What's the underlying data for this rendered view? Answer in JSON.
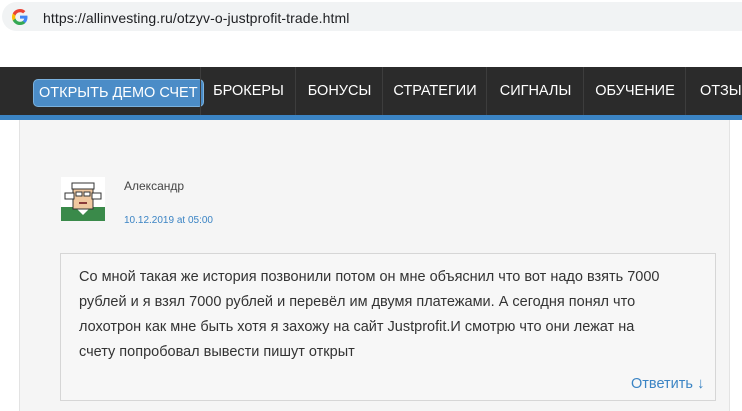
{
  "browser": {
    "url": "https://allinvesting.ru/otzyv-o-justprofit-trade.html",
    "favicon_icon": "google-g-icon"
  },
  "nav": {
    "demo_button": "ОТКРЫТЬ ДЕМО СЧЕТ",
    "items": [
      "БРОКЕРЫ",
      "БОНУСЫ",
      "СТРАТЕГИИ",
      "СИГНАЛЫ",
      "ОБУЧЕНИЕ",
      "ОТЗЫВЫ"
    ],
    "accent_color": "#3b84c4"
  },
  "comment": {
    "avatar_icon": "avatar-icon",
    "author": "Александр",
    "date": "10.12.2019 at 05:00",
    "lines": [
      "Со мной такая же история позвонили потом он мне объяснил что вот надо взять 7000",
      "рублей и я взял 7000 рублей и перевёл им двумя платежами. А сегодня понял что",
      "лохотрон как мне быть хотя я захожу на сайт Justprofit.И смотрю что они лежат на",
      "счету попробовал вывести пишут открыт"
    ],
    "reply_label": "Ответить",
    "reply_icon": "arrow-down-icon"
  }
}
